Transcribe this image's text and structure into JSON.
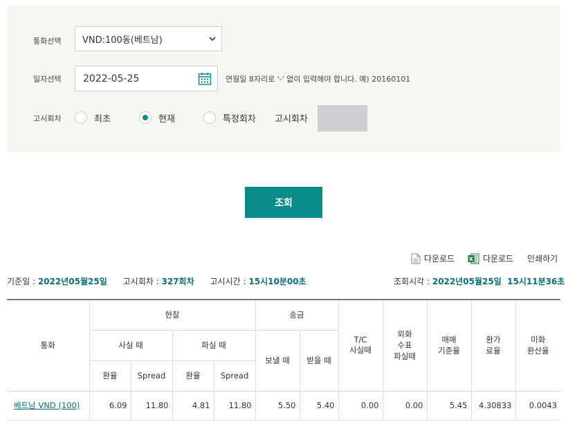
{
  "search": {
    "currency_label": "통화선택",
    "currency_value": "VND:100동(베트남)",
    "date_label": "일자선택",
    "date_value": "2022-05-25",
    "date_hint": "연월일 8자리로 '-' 없이 입력해야 합니다. 예) 20160101",
    "round_label": "고시회차",
    "round_options": [
      "최초",
      "현재",
      "특정회차"
    ],
    "round_selected": 1,
    "round_number_label": "고시회차"
  },
  "query_button": "조회",
  "toolbar": {
    "download1": "다운로드",
    "download2": "다운로드",
    "print": "인쇄하기"
  },
  "info": {
    "base_date_label": "기준일 :",
    "base_date": "2022년05월25일",
    "round_label": "고시회차 :",
    "round": "327회차",
    "time_label": "고시시간 :",
    "time": "15시10분00초",
    "query_time_label": "조회시각 :",
    "query_time": "2022년05월25일  15시11분36초"
  },
  "table": {
    "headers": {
      "currency": "통화",
      "cash": "현찰",
      "remit": "송금",
      "buy": "사실 때",
      "sell": "파실 때",
      "rate": "환율",
      "spread": "Spread",
      "send": "보낼 때",
      "receive": "받을 때",
      "tc": "T/C\n사실때",
      "fx_check": "외화\n수표\n파실때",
      "base_rate": "매매\n기준율",
      "conv_rate": "환가\n료율",
      "usd_rate": "미화\n환산율"
    },
    "row": {
      "currency": "베트남 VND (100)",
      "cash_buy_rate": "6.09",
      "cash_buy_spread": "11.80",
      "cash_sell_rate": "4.81",
      "cash_sell_spread": "11.80",
      "send": "5.50",
      "receive": "5.40",
      "tc": "0.00",
      "fx_check": "0.00",
      "base_rate": "5.45",
      "conv_rate": "4.30833",
      "usd_rate": "0.0043"
    }
  },
  "colors": {
    "accent": "#0a8c8a",
    "panel_bg": "#f6f6f2"
  }
}
